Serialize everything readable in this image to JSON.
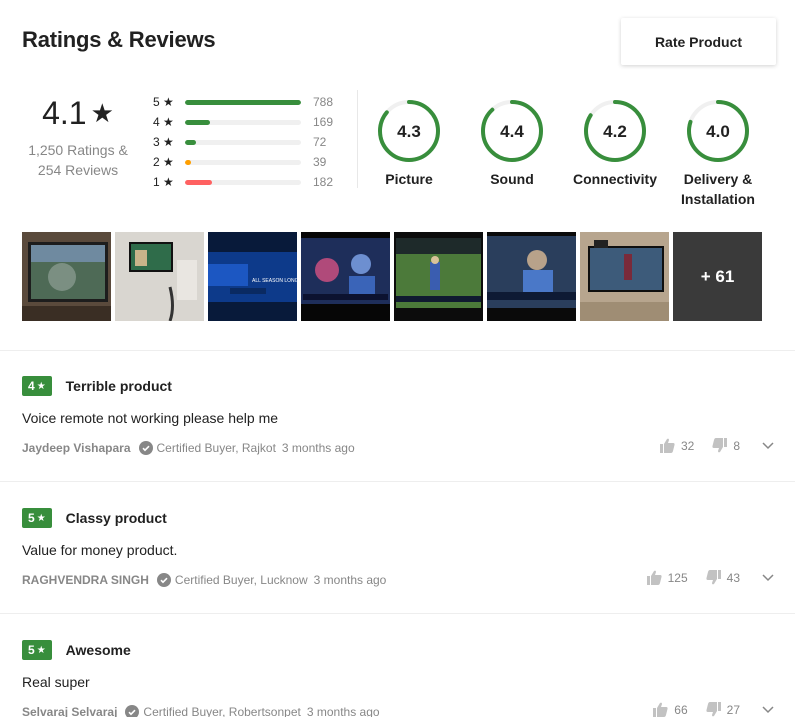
{
  "header": {
    "title": "Ratings & Reviews",
    "rate_button": "Rate Product"
  },
  "overall": {
    "score": "4.1",
    "star": "★",
    "ratings_line": "1,250 Ratings &",
    "reviews_line": "254 Reviews"
  },
  "distribution": [
    {
      "label": "5 ★",
      "count": "788",
      "fraction": 1.0,
      "color": "#388e3c"
    },
    {
      "label": "4 ★",
      "count": "169",
      "fraction": 0.214,
      "color": "#388e3c"
    },
    {
      "label": "3 ★",
      "count": "72",
      "fraction": 0.091,
      "color": "#388e3c"
    },
    {
      "label": "2 ★",
      "count": "39",
      "fraction": 0.05,
      "color": "#ff9f00"
    },
    {
      "label": "1 ★",
      "count": "182",
      "fraction": 0.231,
      "color": "#ff6161"
    }
  ],
  "aspects": [
    {
      "score": "4.3",
      "name_line1": "Picture",
      "name_line2": "",
      "value": 4.3
    },
    {
      "score": "4.4",
      "name_line1": "Sound",
      "name_line2": "",
      "value": 4.4
    },
    {
      "score": "4.2",
      "name_line1": "Connectivity",
      "name_line2": "",
      "value": 4.2
    },
    {
      "score": "4.0",
      "name_line1": "Delivery &",
      "name_line2": "Installation",
      "value": 4.0
    }
  ],
  "photos": {
    "more_label": "+ 61"
  },
  "reviews": [
    {
      "rating": "4",
      "star": "★",
      "title": "Terrible product",
      "body": "Voice remote not working please help me",
      "author": "Jaydeep Vishapara",
      "certified": "Certified Buyer, Rajkot",
      "time": "3 months ago",
      "likes": "32",
      "dislikes": "8"
    },
    {
      "rating": "5",
      "star": "★",
      "title": "Classy product",
      "body": "Value for money product.",
      "author": "RAGHVENDRA SINGH",
      "certified": "Certified Buyer, Lucknow",
      "time": "3 months ago",
      "likes": "125",
      "dislikes": "43"
    },
    {
      "rating": "5",
      "star": "★",
      "title": "Awesome",
      "body": "Real super",
      "author": "Selvaraj Selvaraj",
      "certified": "Certified Buyer, Robertsonpet",
      "time": "3 months ago",
      "likes": "66",
      "dislikes": "27"
    }
  ],
  "colors": {
    "green": "#388e3c",
    "muted": "#878787",
    "ring_track": "#f0f0f0"
  }
}
